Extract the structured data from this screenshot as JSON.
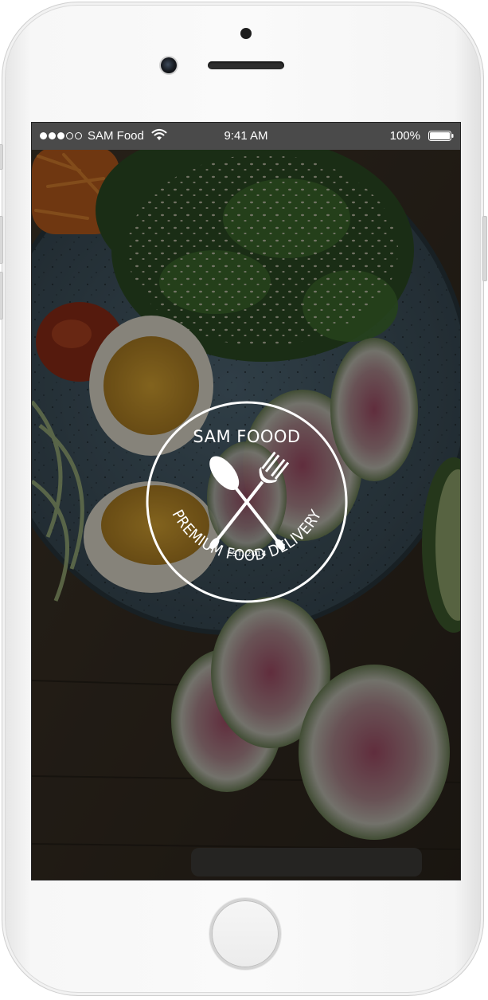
{
  "status_bar": {
    "signal_dots_filled": 3,
    "signal_dots_total": 5,
    "carrier": "SAM Food",
    "time": "9:41 AM",
    "battery_percent": "100%",
    "battery_level": 1.0,
    "wifi_icon": "wifi-icon",
    "battery_icon": "battery-icon"
  },
  "splash": {
    "brand": "SAM FOOOD",
    "established": "EST. 2014",
    "tagline": "PREMIUM FOOD DELIVERY",
    "logo_icon": "crossed-spoon-fork-icon",
    "background": "salad-bowl-photo"
  },
  "colors": {
    "status_bar_bg": "#4a4a4a",
    "logo_color": "#ffffff",
    "phone_body": "#f7f7f7"
  }
}
